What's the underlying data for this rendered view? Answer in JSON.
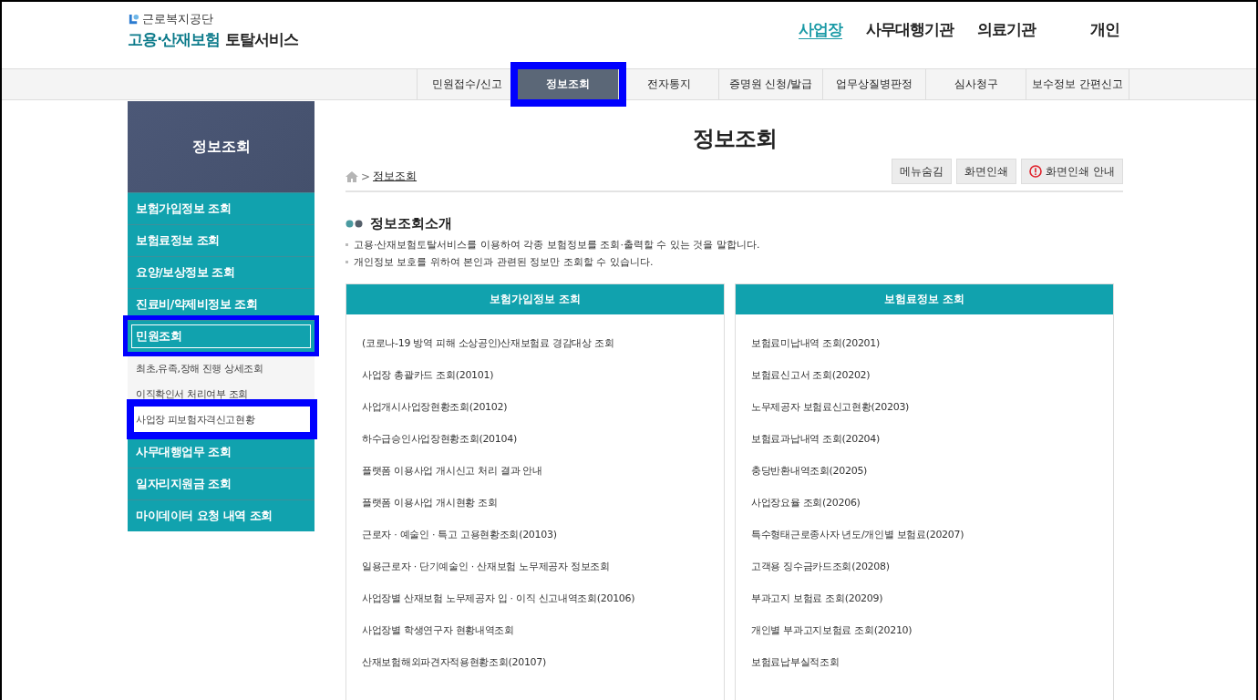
{
  "logo": {
    "org": "근로복지공단",
    "service": "고용·산재보험",
    "suffix": "토탈서비스"
  },
  "top_nav": [
    {
      "label": "사업장",
      "selected": true
    },
    {
      "label": "사무대행기관",
      "selected": false
    },
    {
      "label": "의료기관",
      "selected": false
    },
    {
      "label": "개인",
      "selected": false
    }
  ],
  "sub_nav": [
    {
      "label": "민원접수/신고",
      "selected": false,
      "highlighted": false
    },
    {
      "label": "정보조회",
      "selected": true,
      "highlighted": true
    },
    {
      "label": "전자통지",
      "selected": false,
      "highlighted": false
    },
    {
      "label": "증명원 신청/발급",
      "selected": false,
      "highlighted": false
    },
    {
      "label": "업무상질병판정",
      "selected": false,
      "highlighted": false
    },
    {
      "label": "심사청구",
      "selected": false,
      "highlighted": false
    },
    {
      "label": "보수정보 간편신고",
      "selected": false,
      "highlighted": false
    }
  ],
  "sidebar": {
    "title": "정보조회",
    "items": [
      {
        "label": "보험가입정보 조회",
        "expanded": false,
        "highlighted": false
      },
      {
        "label": "보험료정보 조회",
        "expanded": false,
        "highlighted": false
      },
      {
        "label": "요양/보상정보 조회",
        "expanded": false,
        "highlighted": false
      },
      {
        "label": "진료비/약제비정보 조회",
        "expanded": false,
        "highlighted": false
      },
      {
        "label": "민원조회",
        "expanded": true,
        "highlighted": true,
        "children": [
          {
            "label": "최초,유족,장해 진행 상세조회",
            "selected": false,
            "highlighted": false
          },
          {
            "label": "이직확인서 처리여부 조회",
            "selected": false,
            "highlighted": false
          },
          {
            "label": "사업장 피보험자격신고현황",
            "selected": true,
            "highlighted": true
          }
        ]
      },
      {
        "label": "사무대행업무 조회",
        "expanded": false,
        "highlighted": false
      },
      {
        "label": "일자리지원금 조회",
        "expanded": false,
        "highlighted": false
      },
      {
        "label": "마이데이터 요청 내역 조회",
        "expanded": false,
        "highlighted": false
      }
    ]
  },
  "page_title": "정보조회",
  "breadcrumb_separator": ">",
  "breadcrumb": "정보조회",
  "buttons": [
    {
      "label": "메뉴숨김",
      "kind": "plain"
    },
    {
      "label": "화면인쇄",
      "kind": "plain"
    },
    {
      "label": "화면인쇄 안내",
      "kind": "info"
    }
  ],
  "intro": {
    "heading": "정보조회소개",
    "lines": [
      "고용·산재보험토탈서비스를 이용하여 각종 보험정보를 조회·출력할 수 있는 것을 말합니다.",
      "개인정보 보호를 위하여 본인과 관련된 정보만 조회할 수 있습니다."
    ]
  },
  "cards": [
    {
      "title": "보험가입정보 조회",
      "items": [
        "(코로나-19 방역 피해 소상공인)산재보험료 경감대상 조회",
        "사업장 총괄카드 조회(20101)",
        "사업개시사업장현황조회(20102)",
        "하수급승인사업장현황조회(20104)",
        "플랫폼 이용사업 개시신고 처리 결과 안내",
        "플랫폼 이용사업 개시현황 조회",
        "근로자 · 예술인 · 특고 고용현황조회(20103)",
        "일용근로자 · 단기예술인 · 산재보험 노무제공자 정보조회",
        "사업장별 산재보험 노무제공자 입 · 이직 신고내역조회(20106)",
        "사업장별 학생연구자 현황내역조회",
        "산재보험해외파견자적용현황조회(20107)"
      ]
    },
    {
      "title": "보험료정보 조회",
      "items": [
        "보험료미납내역 조회(20201)",
        "보험료신고서 조회(20202)",
        "노무제공자 보험료신고현황(20203)",
        "보험료과납내역 조회(20204)",
        "충당반환내역조회(20205)",
        "사업장요율 조회(20206)",
        "특수형태근로종사자 년도/개인별 보험료(20207)",
        "고객용 징수금카드조회(20208)",
        "부과고지 보험료 조회(20209)",
        "개인별 부과고지보험료 조회(20210)",
        "보험료납부실적조회"
      ]
    }
  ]
}
